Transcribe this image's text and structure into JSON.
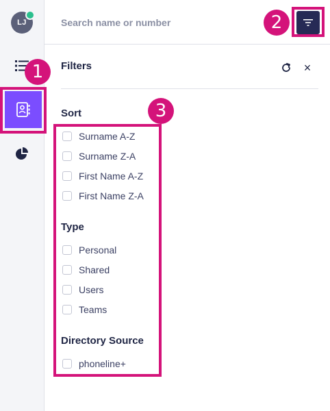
{
  "sidebar": {
    "avatar_initials": "LJ",
    "presence_color": "#2bbf8e",
    "active_color": "#7b4dff",
    "items": [
      {
        "icon": "list-icon"
      },
      {
        "icon": "contact-book-icon",
        "active": true
      },
      {
        "icon": "pie-chart-icon"
      }
    ]
  },
  "search": {
    "placeholder": "Search name or number",
    "filter_icon": "filter-icon"
  },
  "filters": {
    "title": "Filters",
    "refresh_icon": "refresh-icon",
    "close_label": "×",
    "sections": [
      {
        "title": "Sort",
        "options": [
          "Surname A-Z",
          "Surname Z-A",
          "First Name A-Z",
          "First Name Z-A"
        ]
      },
      {
        "title": "Type",
        "options": [
          "Personal",
          "Shared",
          "Users",
          "Teams"
        ]
      },
      {
        "title": "Directory Source",
        "options": [
          "phoneline+"
        ]
      }
    ]
  },
  "callouts": {
    "color": "#d4137a",
    "labels": [
      "1",
      "2",
      "3"
    ]
  }
}
